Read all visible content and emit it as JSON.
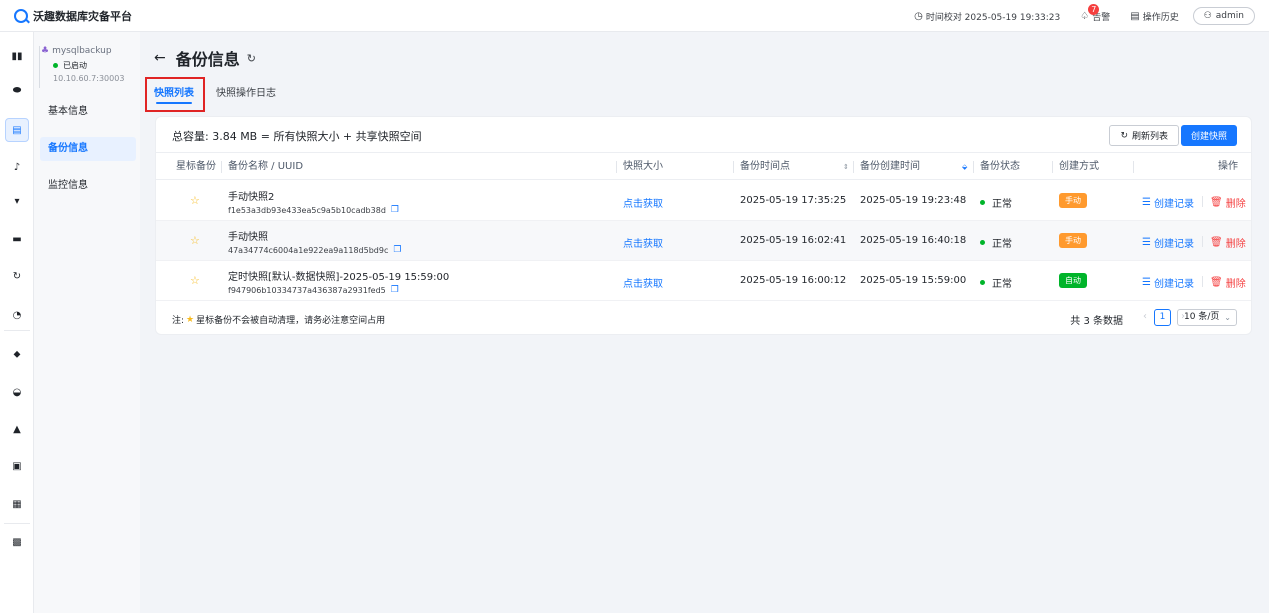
{
  "app": {
    "title": "沃趣数据库灾备平台"
  },
  "topbar": {
    "time_label": "时间校对 2025-05-19 19:33:23",
    "alert_label": "告警",
    "alert_count": "7",
    "history_label": "操作历史",
    "user": "admin"
  },
  "instance": {
    "name": "mysqlbackup",
    "status": "已启动",
    "address": "10.10.60.7:30003"
  },
  "sidebar": {
    "items": [
      {
        "label": "基本信息"
      },
      {
        "label": "备份信息"
      },
      {
        "label": "监控信息"
      }
    ]
  },
  "page": {
    "title": "备份信息",
    "tabs": [
      {
        "label": "快照列表"
      },
      {
        "label": "快照操作日志"
      }
    ]
  },
  "summary": {
    "capacity": "总容量: 3.84 MB = 所有快照大小 + 共享快照空间",
    "refresh_label": "刷新列表",
    "create_label": "创建快照"
  },
  "table": {
    "headers": {
      "star": "星标备份",
      "name": "备份名称 / UUID",
      "size": "快照大小",
      "point": "备份时间点",
      "created": "备份创建时间",
      "status": "备份状态",
      "method": "创建方式",
      "actions": "操作"
    },
    "rows": [
      {
        "name": "手动快照2",
        "uuid": "f1e53a3db93e433ea5c9a5b10cadb38d",
        "size": "点击获取",
        "point": "2025-05-19 17:35:25",
        "created": "2025-05-19 19:23:48",
        "status": "正常",
        "method": "手动",
        "record": "创建记录",
        "delete": "删除"
      },
      {
        "name": "手动快照",
        "uuid": "47a34774c6004a1e922ea9a118d5bd9c",
        "size": "点击获取",
        "point": "2025-05-19 16:02:41",
        "created": "2025-05-19 16:40:18",
        "status": "正常",
        "method": "手动",
        "record": "创建记录",
        "delete": "删除"
      },
      {
        "name": "定时快照[默认-数据快照]-2025-05-19 15:59:00",
        "uuid": "f947906b10334737a436387a2931fed5",
        "size": "点击获取",
        "point": "2025-05-19 16:00:12",
        "created": "2025-05-19 15:59:00",
        "status": "正常",
        "method": "自动",
        "record": "创建记录",
        "delete": "删除"
      }
    ]
  },
  "footer": {
    "note_prefix": "注:",
    "note_text": "星标备份不会被自动清理，请务必注意空间占用",
    "total": "共 3 条数据",
    "current_page": "1",
    "page_size": "10 条/页"
  },
  "colors": {
    "accent": "#1677ff",
    "success": "#00b42a",
    "warning": "#ff9a2e",
    "danger": "#f53f3f"
  }
}
